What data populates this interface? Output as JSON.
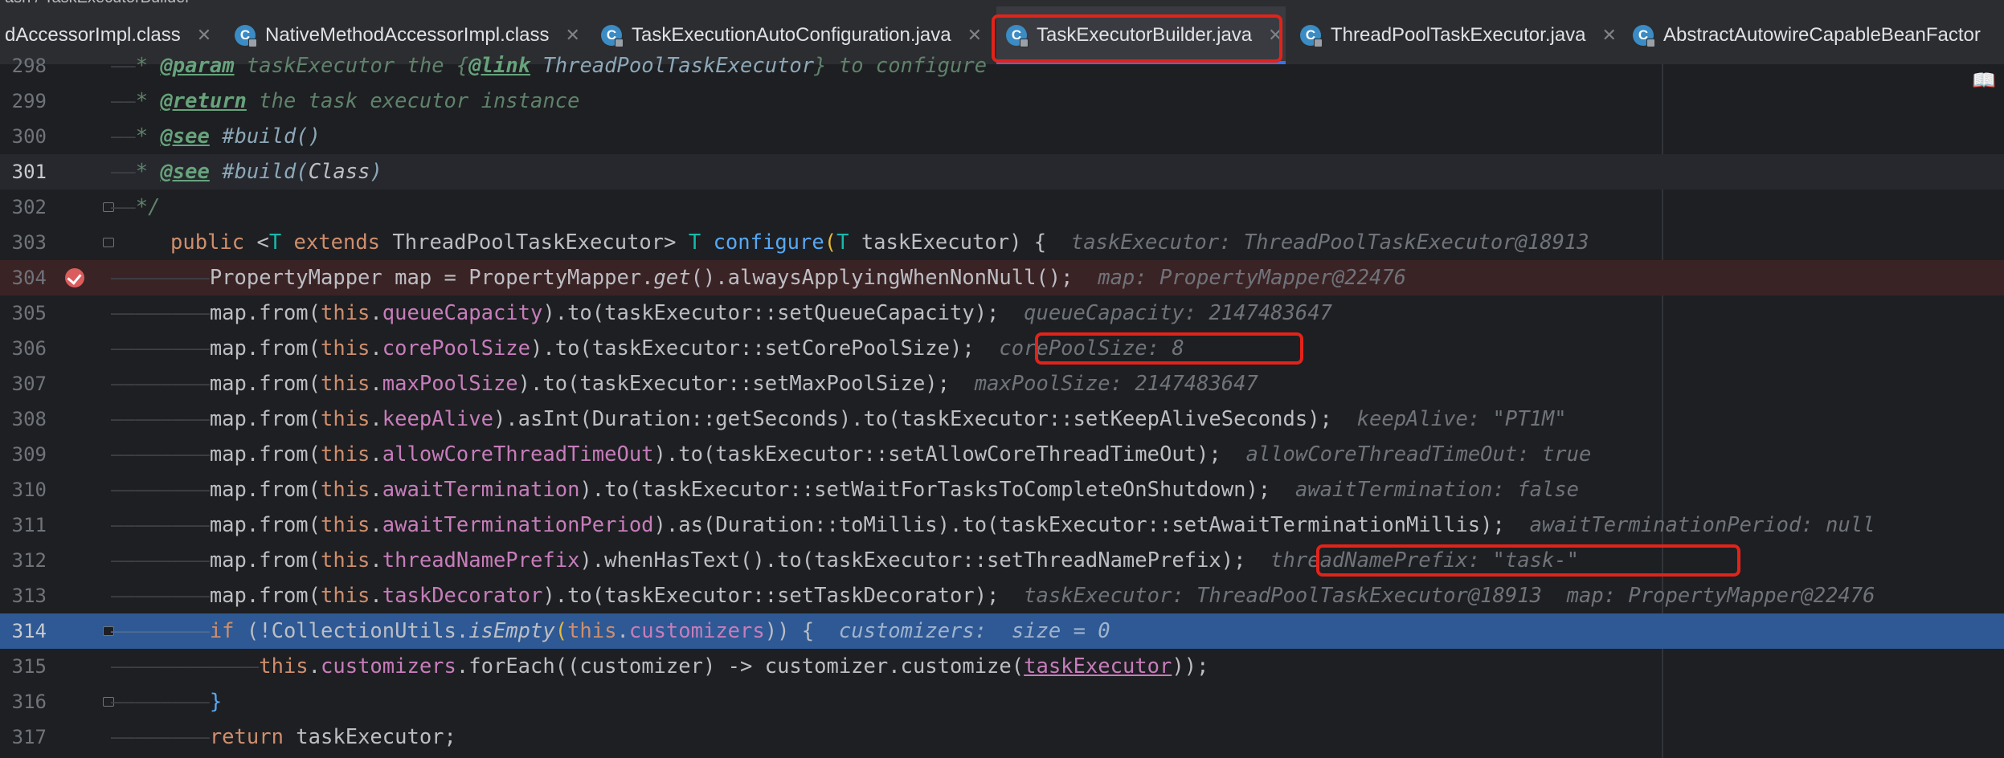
{
  "breadcrumb": {
    "text": "ash / TaskExecutorBuilder"
  },
  "tabs": [
    {
      "label": "dAccessorImpl.class",
      "icon": "class-file-icon",
      "active": false
    },
    {
      "label": "NativeMethodAccessorImpl.class",
      "icon": "class-file-icon",
      "active": false
    },
    {
      "label": "TaskExecutionAutoConfiguration.java",
      "icon": "java-class-icon",
      "active": false
    },
    {
      "label": "TaskExecutorBuilder.java",
      "icon": "java-class-icon",
      "active": true
    },
    {
      "label": "ThreadPoolTaskExecutor.java",
      "icon": "java-class-icon",
      "active": false
    },
    {
      "label": "AbstractAutowireCapableBeanFactor",
      "icon": "java-class-icon",
      "active": false
    }
  ],
  "tab_icon_letter": "C",
  "close_glyph": "✕",
  "reader_glyph": "📖",
  "colors": {
    "accent": "#3574f0",
    "highlight_box": "#e2231a",
    "selected_line": "#2e5994",
    "breakpoint": "#db5c5c"
  },
  "editor": {
    "line_numbers": [
      "298",
      "299",
      "300",
      "301",
      "302",
      "303",
      "304",
      "305",
      "306",
      "307",
      "308",
      "309",
      "310",
      "311",
      "312",
      "313",
      "314",
      "315",
      "316",
      "317"
    ],
    "guides": {
      "d1": "——",
      "d2": "————————",
      "d3": "————————————"
    },
    "l298": {
      "star": "* ",
      "tag": "@param",
      "t1": " taskExecutor the {",
      "link": "@link",
      "ref": " ThreadPoolTaskExecutor",
      "t2": "} to configure"
    },
    "l299": {
      "star": "* ",
      "tag": "@return",
      "t1": " the task executor instance"
    },
    "l300": {
      "star": "* ",
      "tag": "@see",
      "ref": " #build()"
    },
    "l301": {
      "star": "* ",
      "tag": "@see",
      "ref": " #build(",
      "cls": "Class",
      "close": ")"
    },
    "l302": {
      "t": "*/"
    },
    "l303": {
      "kw": "public",
      "lt": " <",
      "T": "T",
      "ext": " extends",
      "cls": " ThreadPoolTaskExecutor",
      "gt": "> ",
      "T2": "T",
      "name": " configure",
      "op": "(",
      "T3": "T",
      "param": " taskExecutor",
      "cp": ") {",
      "hint": "taskExecutor: ThreadPoolTaskExecutor@18913"
    },
    "l304": {
      "a": "PropertyMapper map = PropertyMapper.",
      "get": "get",
      "b": "().alwaysApplyingWhenNonNull();",
      "hint": "map: PropertyMapper@22476"
    },
    "l305": {
      "a": "map.from(",
      "this": "this",
      "dot": ".",
      "f": "queueCapacity",
      "b": ").to(taskExecutor::setQueueCapacity);",
      "hint": "queueCapacity: 2147483647"
    },
    "l306": {
      "a": "map.from(",
      "this": "this",
      "dot": ".",
      "f": "corePoolSize",
      "b": ").to(taskExecutor::setCorePoolSize);",
      "hint": "corePoolSize: 8"
    },
    "l307": {
      "a": "map.from(",
      "this": "this",
      "dot": ".",
      "f": "maxPoolSize",
      "b": ").to(taskExecutor::setMaxPoolSize);",
      "hint": "maxPoolSize: 2147483647"
    },
    "l308": {
      "a": "map.from(",
      "this": "this",
      "dot": ".",
      "f": "keepAlive",
      "b": ").asInt(Duration::getSeconds).to(taskExecutor::setKeepAliveSeconds);",
      "hint": "keepAlive: \"PT1M\""
    },
    "l309": {
      "a": "map.from(",
      "this": "this",
      "dot": ".",
      "f": "allowCoreThreadTimeOut",
      "b": ").to(taskExecutor::setAllowCoreThreadTimeOut);",
      "hint": "allowCoreThreadTimeOut: true"
    },
    "l310": {
      "a": "map.from(",
      "this": "this",
      "dot": ".",
      "f": "awaitTermination",
      "b": ").to(taskExecutor::setWaitForTasksToCompleteOnShutdown);",
      "hint": "awaitTermination: false"
    },
    "l311": {
      "a": "map.from(",
      "this": "this",
      "dot": ".",
      "f": "awaitTerminationPeriod",
      "b": ").as(Duration::toMillis).to(taskExecutor::setAwaitTerminationMillis);",
      "hint": "awaitTerminationPeriod: null"
    },
    "l312": {
      "a": "map.from(",
      "this": "this",
      "dot": ".",
      "f": "threadNamePrefix",
      "b": ").whenHasText().to(taskExecutor::setThreadNamePrefix);",
      "hint": "threadNamePrefix: \"task-\""
    },
    "l313": {
      "a": "map.from(",
      "this": "this",
      "dot": ".",
      "f": "taskDecorator",
      "b": ").to(taskExecutor::setTaskDecorator);",
      "hint": "taskExecutor: ThreadPoolTaskExecutor@18913",
      "hint2": "map: PropertyMapper@22476"
    },
    "l314": {
      "kw": "if",
      "a": " (!CollectionUtils.",
      "m": "isEmpty",
      "b": "(",
      "this": "this",
      "dot": ".",
      "f": "customizers",
      "c": ")) {",
      "hint": "customizers:  size = 0"
    },
    "l315": {
      "this": "this",
      "dot": ".",
      "f": "customizers",
      "a": ".forEach((customizer) -> customizer.customize(",
      "v": "taskExecutor",
      "b": "));"
    },
    "l316": {
      "t": "}"
    },
    "l317": {
      "kw": "return",
      "a": " taskExecutor;"
    }
  }
}
